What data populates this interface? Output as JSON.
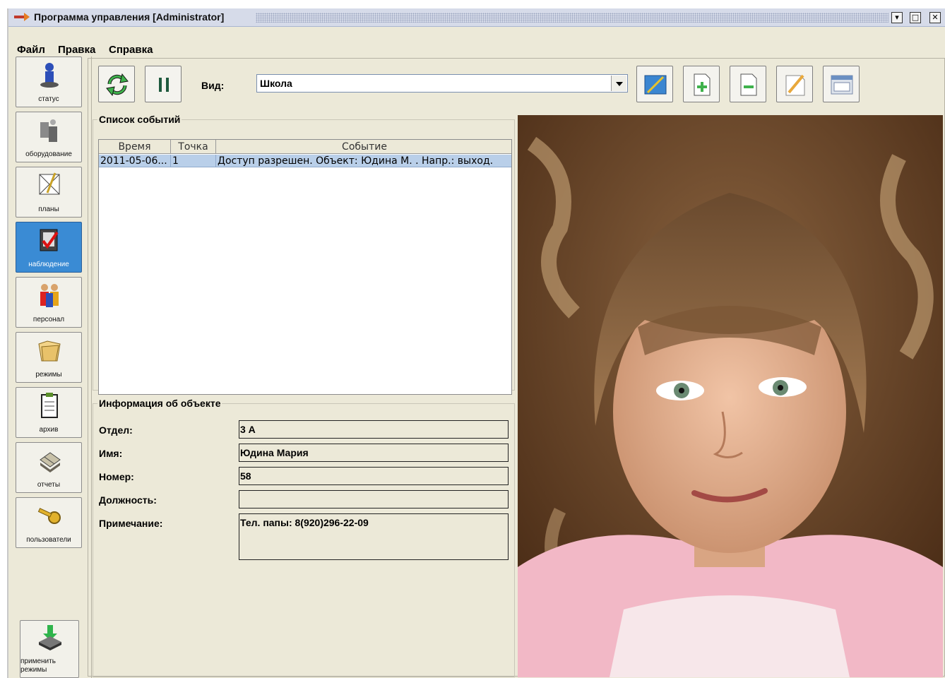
{
  "window": {
    "title": "Программа управления [Administrator]"
  },
  "menu": [
    "Файл",
    "Правка",
    "Справка"
  ],
  "sidebar": {
    "items": [
      {
        "label": "статус",
        "icon": "status-icon"
      },
      {
        "label": "оборудование",
        "icon": "equipment-icon"
      },
      {
        "label": "планы",
        "icon": "plans-icon"
      },
      {
        "label": "наблюдение",
        "icon": "monitoring-icon",
        "active": true
      },
      {
        "label": "персонал",
        "icon": "staff-icon"
      },
      {
        "label": "режимы",
        "icon": "folder-icon"
      },
      {
        "label": "архив",
        "icon": "clipboard-icon"
      },
      {
        "label": "отчеты",
        "icon": "reports-icon"
      },
      {
        "label": "пользователи",
        "icon": "key-icon"
      }
    ],
    "apply": {
      "line1": "применить",
      "line2": "режимы",
      "icon": "download-arrow-icon"
    }
  },
  "toolbar": {
    "vid_label": "Вид:",
    "vid_value": "Школа",
    "buttons": [
      "refresh-icon",
      "pause-icon",
      "edit-view-icon",
      "add-document-icon",
      "remove-document-icon",
      "pencil-icon",
      "window-icon"
    ]
  },
  "events": {
    "title": "Список событий",
    "columns": [
      "Время",
      "Точка",
      "Событие"
    ],
    "rows": [
      {
        "time": "2011-05-06...",
        "point": "1",
        "event": "Доступ разрешен. Объект: Юдина М. . Напр.: выход."
      }
    ]
  },
  "info": {
    "title": "Информация об объекте",
    "fields": [
      {
        "label": "Отдел:",
        "value": "3 А"
      },
      {
        "label": "Имя:",
        "value": "Юдина Мария"
      },
      {
        "label": "Номер:",
        "value": "58"
      },
      {
        "label": "Должность:",
        "value": ""
      },
      {
        "label": "Примечание:",
        "value": "Тел. папы: 8(920)296-22-09"
      }
    ]
  },
  "colors": {
    "active_sidebar": "#3a8bd4",
    "selected_row": "#b9cfe9",
    "panel_bg": "#ECE9D8"
  }
}
